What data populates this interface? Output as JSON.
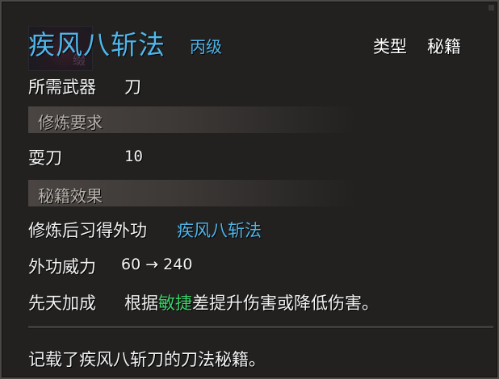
{
  "header": {
    "title": "疾风八斩法",
    "rank": "丙级",
    "type_label": "类型",
    "type_value": "秘籍",
    "icon_glyph": "缀"
  },
  "weapon": {
    "label": "所需武器",
    "value": "刀"
  },
  "requirements": {
    "section_title": "修炼要求",
    "items": [
      {
        "label": "耍刀",
        "value": "10"
      }
    ]
  },
  "effects": {
    "section_title": "秘籍效果",
    "learned_label": "修炼后习得外功",
    "learned_value": "疾风八斩法",
    "power_label": "外功威力",
    "power_value": "60 → 240",
    "bonus_label": "先天加成",
    "bonus_prefix": "根据",
    "bonus_highlight": "敏捷",
    "bonus_suffix": "差提升伤害或降低伤害。"
  },
  "description": "记载了疾风八斩刀的刀法秘籍。",
  "colors": {
    "title": "#4fb6ea",
    "highlight_attribute": "#3ecf6a",
    "panel_background": "#222120",
    "section_bar": "#4a4543"
  }
}
